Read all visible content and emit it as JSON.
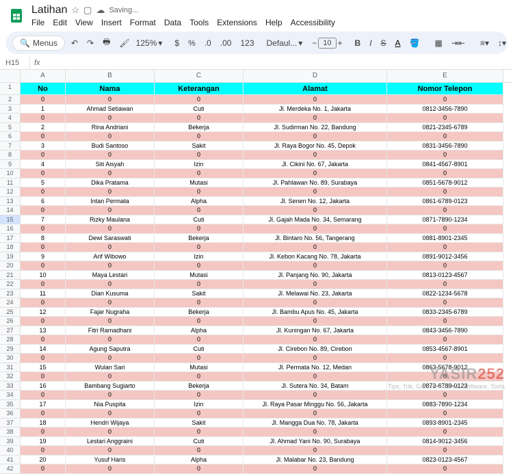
{
  "doc": {
    "title": "Latihan",
    "saving": "Saving..."
  },
  "menu": {
    "file": "File",
    "edit": "Edit",
    "view": "View",
    "insert": "Insert",
    "format": "Format",
    "data": "Data",
    "tools": "Tools",
    "extensions": "Extensions",
    "help": "Help",
    "accessibility": "Accessibility"
  },
  "toolbar": {
    "menus": "Menus",
    "zoom": "125%",
    "font": "Defaul...",
    "size": "10"
  },
  "cellref": "H15",
  "cols": [
    "A",
    "B",
    "C",
    "D",
    "E"
  ],
  "headers": {
    "no": "No",
    "nama": "Nama",
    "ket": "Keterangan",
    "alamat": "Alamat",
    "telp": "Nomor Telepon"
  },
  "zero": "0",
  "records": [
    {
      "no": "1",
      "nama": "Ahmad Setiawan",
      "ket": "Cuti",
      "alamat": "Jl. Merdeka No. 1, Jakarta",
      "telp": "0812-3456-7890"
    },
    {
      "no": "2",
      "nama": "Rina Andriani",
      "ket": "Bekerja",
      "alamat": "Jl. Sudirman No. 22, Bandung",
      "telp": "0821-2345-6789"
    },
    {
      "no": "3",
      "nama": "Budi Santoso",
      "ket": "Sakit",
      "alamat": "Jl. Raya Bogor No. 45, Depok",
      "telp": "0831-3456-7890"
    },
    {
      "no": "4",
      "nama": "Siti Aisyah",
      "ket": "Izin",
      "alamat": "Jl. Cikini No. 67, Jakarta",
      "telp": "0841-4567-8901"
    },
    {
      "no": "5",
      "nama": "Dika Pratama",
      "ket": "Mutasi",
      "alamat": "Jl. Pahlawan No. 89, Surabaya",
      "telp": "0851-5678-9012"
    },
    {
      "no": "6",
      "nama": "Intan Permata",
      "ket": "Alpha",
      "alamat": "Jl. Senen No. 12, Jakarta",
      "telp": "0861-6789-0123"
    },
    {
      "no": "7",
      "nama": "Rizky Maulana",
      "ket": "Cuti",
      "alamat": "Jl. Gajah Mada No. 34, Semarang",
      "telp": "0871-7890-1234"
    },
    {
      "no": "8",
      "nama": "Dewi Saraswati",
      "ket": "Bekerja",
      "alamat": "Jl. Bintaro No. 56, Tangerang",
      "telp": "0881-8901-2345"
    },
    {
      "no": "9",
      "nama": "Arif Wibowo",
      "ket": "Izin",
      "alamat": "Jl. Kebon Kacang No. 78, Jakarta",
      "telp": "0891-9012-3456"
    },
    {
      "no": "10",
      "nama": "Maya Lestari",
      "ket": "Mutasi",
      "alamat": "Jl. Panjang No. 90, Jakarta",
      "telp": "0813-0123-4567"
    },
    {
      "no": "11",
      "nama": "Dian Kusuma",
      "ket": "Sakit",
      "alamat": "Jl. Melawai No. 23, Jakarta",
      "telp": "0822-1234-5678"
    },
    {
      "no": "12",
      "nama": "Fajar Nugraha",
      "ket": "Bekerja",
      "alamat": "Jl. Bambu Apus No. 45, Jakarta",
      "telp": "0833-2345-6789"
    },
    {
      "no": "13",
      "nama": "Fitri Ramadhani",
      "ket": "Alpha",
      "alamat": "Jl. Kuningan No. 67, Jakarta",
      "telp": "0843-3456-7890"
    },
    {
      "no": "14",
      "nama": "Agung Saputra",
      "ket": "Cuti",
      "alamat": "Jl. Cirebon No. 89, Cirebon",
      "telp": "0853-4567-8901"
    },
    {
      "no": "15",
      "nama": "Wulan Sari",
      "ket": "Mutasi",
      "alamat": "Jl. Permata No. 12, Medan",
      "telp": "0863-5678-9012"
    },
    {
      "no": "16",
      "nama": "Bambang Sugiarto",
      "ket": "Bekerja",
      "alamat": "Jl. Sutera No. 34, Batam",
      "telp": "0873-6789-0123"
    },
    {
      "no": "17",
      "nama": "Nia Puspita",
      "ket": "Izin",
      "alamat": "Jl. Raya Pasar Minggu No. 56, Jakarta",
      "telp": "0883-7890-1234"
    },
    {
      "no": "18",
      "nama": "Hendri Wijaya",
      "ket": "Sakit",
      "alamat": "Jl. Mangga Dua No. 78, Jakarta",
      "telp": "0893-8901-2345"
    },
    {
      "no": "19",
      "nama": "Lestari Anggraini",
      "ket": "Cuti",
      "alamat": "Jl. Ahmad Yani No. 90, Surabaya",
      "telp": "0814-9012-3456"
    },
    {
      "no": "20",
      "nama": "Yusuf Haris",
      "ket": "Alpha",
      "alamat": "Jl. Malabar No. 23, Bandung",
      "telp": "0823-0123-4567"
    }
  ],
  "watermark": {
    "brand1": "YASIR",
    "brand2": "252",
    "sub": "Tips, Trik, Games, Tutorial, Software, Tools"
  }
}
